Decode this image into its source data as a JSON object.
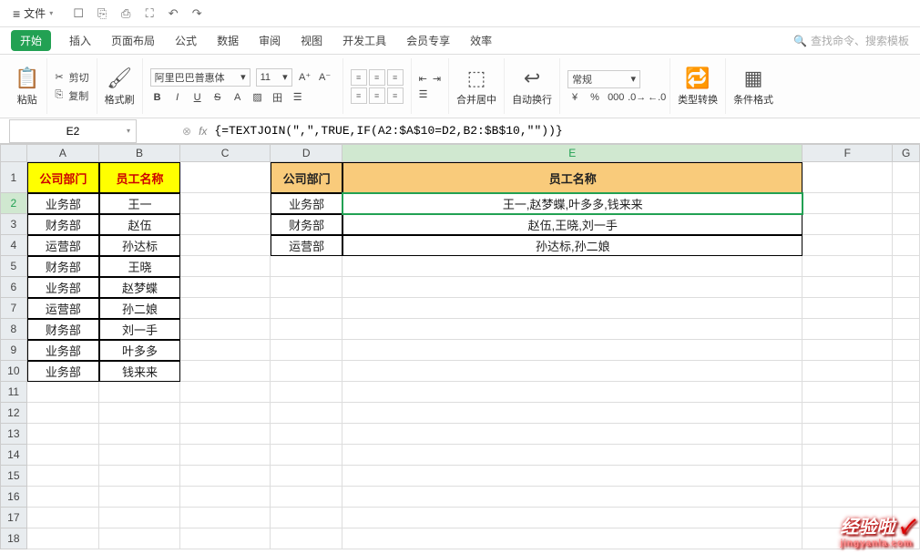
{
  "titlebar": {
    "file": "文件"
  },
  "tabs": {
    "start": "开始",
    "insert": "插入",
    "layout": "页面布局",
    "formula": "公式",
    "data": "数据",
    "review": "审阅",
    "view": "视图",
    "dev": "开发工具",
    "member": "会员专享",
    "effect": "效率",
    "search": "查找命令、搜索模板"
  },
  "ribbon": {
    "paste": "粘贴",
    "cut": "剪切",
    "copy": "复制",
    "format_painter": "格式刷",
    "font_name": "阿里巴巴普惠体",
    "font_size": "11",
    "merge": "合并居中",
    "wrap": "自动换行",
    "general": "常规",
    "type_convert": "类型转换",
    "cond_format": "条件格式"
  },
  "namebox": "E2",
  "formula": "{=TEXTJOIN(\",\",TRUE,IF(A2:$A$10=D2,B2:$B$10,\"\"))}",
  "columns": [
    "A",
    "B",
    "C",
    "D",
    "E",
    "F",
    "G"
  ],
  "rows": [
    "1",
    "2",
    "3",
    "4",
    "5",
    "6",
    "7",
    "8",
    "9",
    "10",
    "11",
    "12",
    "13",
    "14",
    "15",
    "16",
    "17",
    "18"
  ],
  "left_header": {
    "dept": "公司部门",
    "name": "员工名称"
  },
  "left_data": [
    {
      "dept": "业务部",
      "name": "王一"
    },
    {
      "dept": "财务部",
      "name": "赵伍"
    },
    {
      "dept": "运营部",
      "name": "孙达标"
    },
    {
      "dept": "财务部",
      "name": "王晓"
    },
    {
      "dept": "业务部",
      "name": "赵梦蝶"
    },
    {
      "dept": "运营部",
      "name": "孙二娘"
    },
    {
      "dept": "财务部",
      "name": "刘一手"
    },
    {
      "dept": "业务部",
      "name": "叶多多"
    },
    {
      "dept": "业务部",
      "name": "钱来来"
    }
  ],
  "right_header": {
    "dept": "公司部门",
    "name": "员工名称"
  },
  "right_data": [
    {
      "dept": "业务部",
      "names": "王一,赵梦蝶,叶多多,钱来来"
    },
    {
      "dept": "财务部",
      "names": "赵伍,王晓,刘一手"
    },
    {
      "dept": "运营部",
      "names": "孙达标,孙二娘"
    }
  ],
  "watermark": {
    "main": "经验啦",
    "sub": "jingyanla.com"
  }
}
